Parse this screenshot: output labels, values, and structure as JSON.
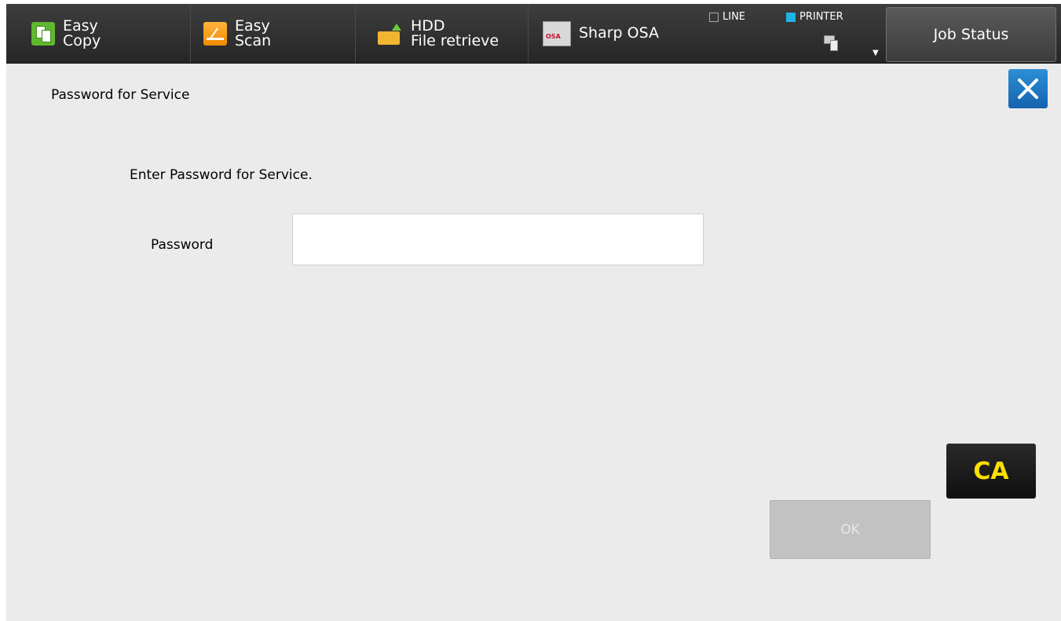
{
  "topbar": {
    "easy_copy": {
      "line1": "Easy",
      "line2": "Copy",
      "icon": "easy-copy-icon",
      "icon_color": "#5fb82e"
    },
    "easy_scan": {
      "line1": "Easy",
      "line2": "Scan",
      "icon": "easy-scan-icon",
      "icon_color": "#f4a11d"
    },
    "hdd": {
      "line1": "HDD",
      "line2": "File retrieve",
      "icon": "folder-upload-icon"
    },
    "sharp_osa": {
      "label": "Sharp OSA",
      "icon": "sharp-osa-icon"
    },
    "indicators": {
      "line": {
        "label": "LINE",
        "active": false
      },
      "printer": {
        "label": "PRINTER",
        "active": true,
        "color": "#1fb4e6"
      }
    },
    "caret": "▼",
    "job_status": "Job Status"
  },
  "screen": {
    "title": "Password for Service",
    "instruction": "Enter Password for Service.",
    "password_label": "Password",
    "password_value": "",
    "close_icon": "close-icon"
  },
  "buttons": {
    "ca": "CA",
    "ok": "OK",
    "ok_enabled": false
  },
  "colors": {
    "accent_blue": "#1a73bd",
    "ca_text": "#ffe000",
    "background": "#ebebeb"
  }
}
